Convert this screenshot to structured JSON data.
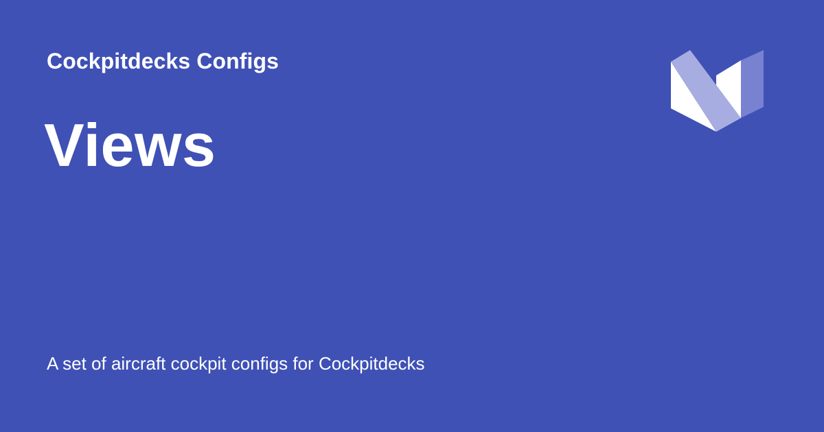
{
  "site": {
    "name": "Cockpitdecks Configs"
  },
  "page": {
    "title": "Views",
    "description": "A set of aircraft cockpit configs for Cockpitdecks"
  },
  "logo": {
    "icon": "material-logo-icon"
  },
  "colors": {
    "background": "#3f51b5",
    "text": "#ffffff",
    "logo_light": "#ffffff",
    "logo_mid": "#a7ade0",
    "logo_dark": "#7982d1"
  }
}
